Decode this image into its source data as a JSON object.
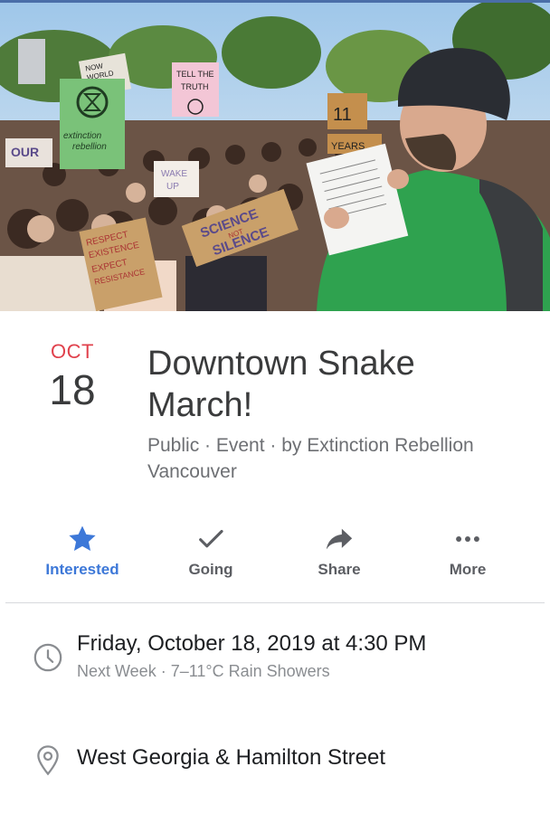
{
  "cover": {
    "signs": [
      "NOW",
      "WORLD",
      "TELL THE",
      "TRUTH",
      "extinction",
      "rebellion",
      "OUR",
      "11",
      "YEARS",
      "SCIENCE",
      "NOT",
      "SILENCE",
      "RESPECT",
      "EXISTENCE",
      "EXPECT",
      "RESISTANCE",
      "WAKE",
      "UP"
    ]
  },
  "event": {
    "month": "OCT",
    "day": "18",
    "title": "Downtown Snake March!",
    "meta": "Public · Event · by Extinction Rebellion Vancouver"
  },
  "actions": [
    {
      "label": "Interested",
      "icon": "star-icon",
      "active": true
    },
    {
      "label": "Going",
      "icon": "check-icon",
      "active": false
    },
    {
      "label": "Share",
      "icon": "share-arrow-icon",
      "active": false
    },
    {
      "label": "More",
      "icon": "more-dots-icon",
      "active": false
    }
  ],
  "details": {
    "datetime": "Friday, October 18, 2019 at 4:30 PM",
    "datetime_sub": "Next Week · 7–11°C Rain Showers",
    "location": "West Georgia & Hamilton Street"
  },
  "colors": {
    "accent": "#3d78d8",
    "month": "#e0414c",
    "jacket": "#2fa24f",
    "topbar": "#4a6ea8"
  }
}
